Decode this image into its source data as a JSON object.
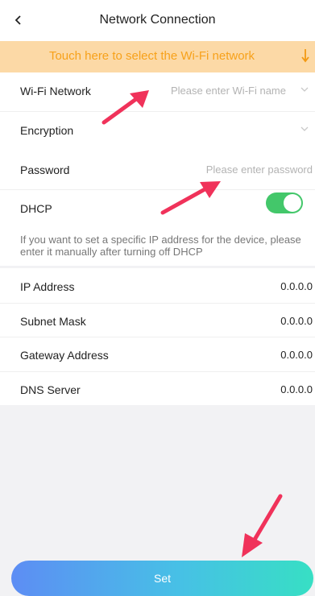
{
  "header": {
    "title": "Network Connection"
  },
  "banner": {
    "text": "Touch here to select the Wi-Fi network"
  },
  "wifi": {
    "label": "Wi-Fi Network",
    "placeholder": "Please enter Wi-Fi name",
    "value": ""
  },
  "encryption": {
    "label": "Encryption",
    "value": ""
  },
  "password": {
    "label": "Password",
    "placeholder": "Please enter password",
    "value": ""
  },
  "dhcp": {
    "label": "DHCP",
    "enabled": true,
    "hint": "If you want to set a specific IP address for the device, please enter it manually after turning off DHCP"
  },
  "network_fields": [
    {
      "label": "IP Address",
      "value": "0.0.0.0"
    },
    {
      "label": "Subnet Mask",
      "value": "0.0.0.0"
    },
    {
      "label": "Gateway Address",
      "value": "0.0.0.0"
    },
    {
      "label": "DNS Server",
      "value": "0.0.0.0"
    }
  ],
  "footer": {
    "set_label": "Set"
  },
  "colors": {
    "accent_green": "#43c76a",
    "banner_bg": "#fcd9a6",
    "banner_text": "#f7a11a",
    "arrow_red": "#f0325a"
  }
}
